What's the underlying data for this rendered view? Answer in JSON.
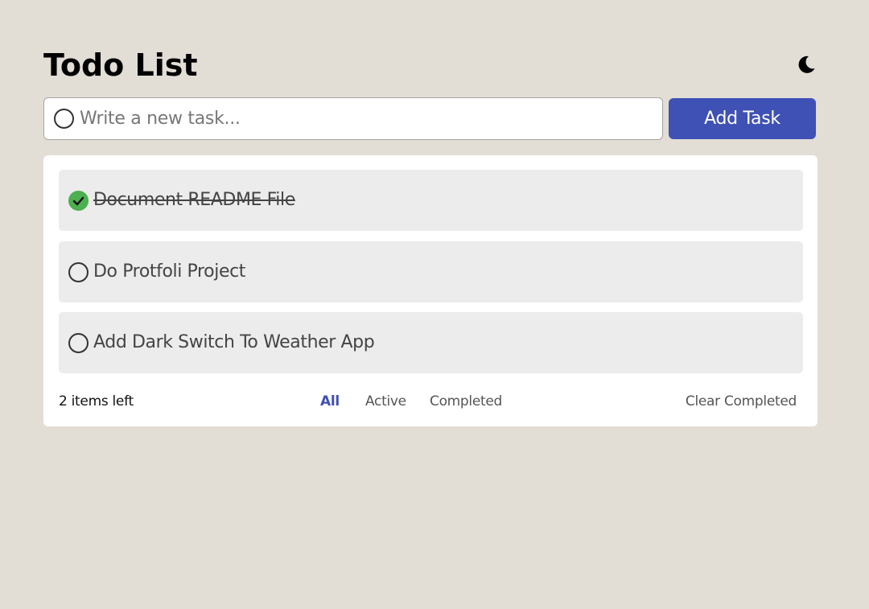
{
  "header": {
    "title": "Todo List",
    "theme_toggle_icon": "moon-icon"
  },
  "new_task": {
    "placeholder": "Write a new task...",
    "value": "",
    "add_label": "Add Task"
  },
  "tasks": [
    {
      "text": "Document README File",
      "completed": true
    },
    {
      "text": "Do Protfoli Project",
      "completed": false
    },
    {
      "text": "Add Dark Switch To Weather App",
      "completed": false
    }
  ],
  "footer": {
    "items_left": "2 items left",
    "filters": [
      "All",
      "Active",
      "Completed"
    ],
    "active_filter": "All",
    "clear_label": "Clear Completed"
  },
  "colors": {
    "background": "#e2ddd5",
    "accent": "#3f51b5",
    "done": "#4caf50"
  }
}
